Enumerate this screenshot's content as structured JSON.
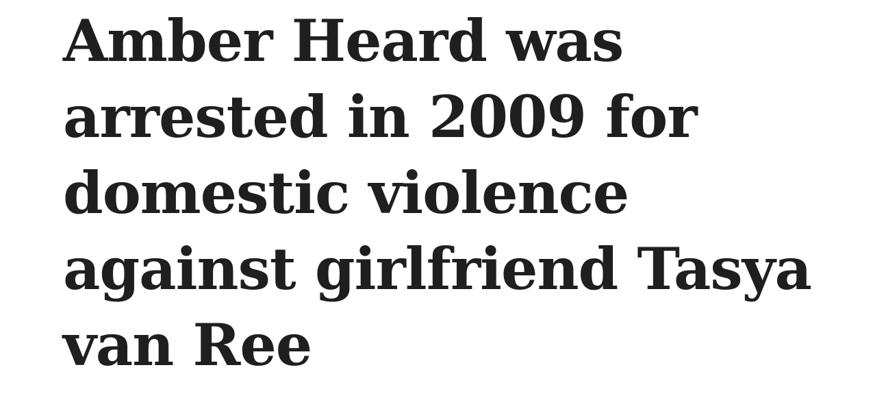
{
  "article": {
    "headline_lines": [
      "Amber Heard was",
      "arrested in 2009 for",
      "domestic violence",
      "against girlfriend Tasya",
      "van Ree"
    ]
  }
}
